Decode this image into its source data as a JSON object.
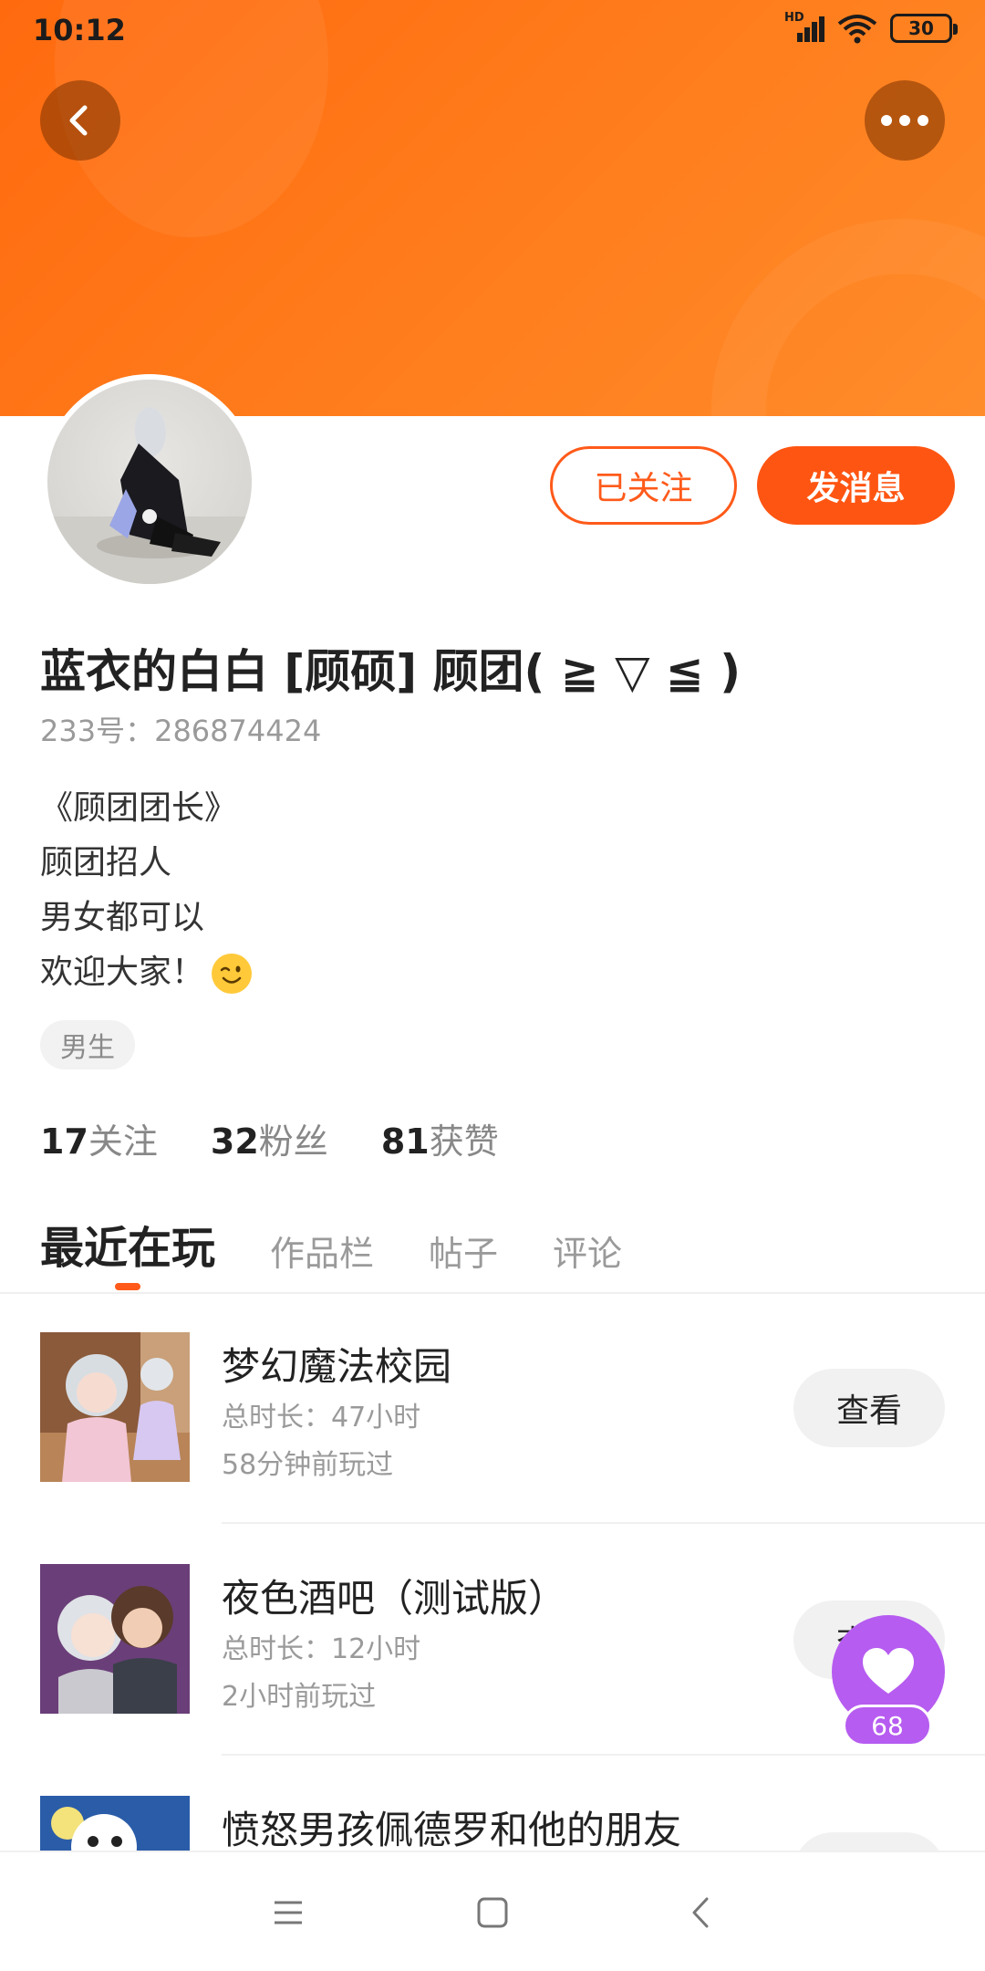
{
  "status_bar": {
    "time": "10:12",
    "network_label": "HD",
    "battery": "30"
  },
  "colors": {
    "brand": "#ff5a1a",
    "header": "#ff7a1a",
    "like": "#b65cf0"
  },
  "header": {
    "back_icon": "back-chevron-icon",
    "more_icon": "more-dots-icon"
  },
  "profile": {
    "follow_label": "已关注",
    "message_label": "发消息",
    "name": "蓝衣的白白 [顾硕] 顾团( ≧ ▽ ≦ )",
    "id_text": "233号：286874424",
    "bio_lines": [
      "《顾团团长》",
      "顾团招人",
      "男女都可以",
      "欢迎大家！"
    ],
    "tag": "男生",
    "stats": [
      {
        "num": "17",
        "label": "关注"
      },
      {
        "num": "32",
        "label": "粉丝"
      },
      {
        "num": "81",
        "label": "获赞"
      }
    ]
  },
  "tabs": [
    {
      "label": "最近在玩",
      "active": true
    },
    {
      "label": "作品栏",
      "active": false
    },
    {
      "label": "帖子",
      "active": false
    },
    {
      "label": "评论",
      "active": false
    }
  ],
  "games": [
    {
      "name": "梦幻魔法校园",
      "duration": "总时长：47小时",
      "last_played": "58分钟前玩过",
      "action": "查看"
    },
    {
      "name": "夜色酒吧（测试版）",
      "duration": "总时长：12小时",
      "last_played": "2小时前玩过",
      "action": "查看"
    },
    {
      "name": "愤怒男孩佩德罗和他的朋友",
      "duration": "",
      "last_played": "",
      "action": ""
    }
  ],
  "like": {
    "icon": "heart-icon",
    "count": "68"
  },
  "nav": {
    "icons": [
      "menu-icon",
      "home-square-icon",
      "back-triangle-icon"
    ]
  }
}
